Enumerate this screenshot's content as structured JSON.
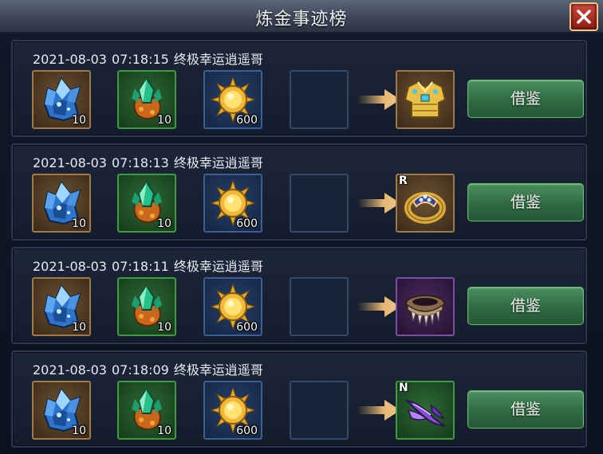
{
  "window": {
    "title": "炼金事迹榜"
  },
  "close_button": {
    "icon": "close-icon"
  },
  "records": [
    {
      "date": "2021-08-03",
      "time": "07:18:15",
      "player": "终极幸运逍遥哥",
      "materials": [
        {
          "icon": "blue-crystal-icon",
          "qty": "10"
        },
        {
          "icon": "green-gem-icon",
          "qty": "10"
        },
        {
          "icon": "gold-sun-coin-icon",
          "qty": "600"
        }
      ],
      "result": {
        "icon": "golden-armor-icon",
        "rarity": ""
      },
      "button_label": "借鉴"
    },
    {
      "date": "2021-08-03",
      "time": "07:18:13",
      "player": "终极幸运逍遥哥",
      "materials": [
        {
          "icon": "blue-crystal-icon",
          "qty": "10"
        },
        {
          "icon": "green-gem-icon",
          "qty": "10"
        },
        {
          "icon": "gold-sun-coin-icon",
          "qty": "600"
        }
      ],
      "result": {
        "icon": "jeweled-ring-icon",
        "rarity": "R"
      },
      "button_label": "借鉴"
    },
    {
      "date": "2021-08-03",
      "time": "07:18:11",
      "player": "终极幸运逍遥哥",
      "materials": [
        {
          "icon": "blue-crystal-icon",
          "qty": "10"
        },
        {
          "icon": "green-gem-icon",
          "qty": "10"
        },
        {
          "icon": "gold-sun-coin-icon",
          "qty": "600"
        }
      ],
      "result": {
        "icon": "spiked-collar-icon",
        "rarity": ""
      },
      "button_label": "借鉴"
    },
    {
      "date": "2021-08-03",
      "time": "07:18:09",
      "player": "终极幸运逍遥哥",
      "materials": [
        {
          "icon": "blue-crystal-icon",
          "qty": "10"
        },
        {
          "icon": "green-gem-icon",
          "qty": "10"
        },
        {
          "icon": "gold-sun-coin-icon",
          "qty": "600"
        }
      ],
      "result": {
        "icon": "purple-claw-icon",
        "rarity": "N"
      },
      "button_label": "借鉴"
    }
  ]
}
